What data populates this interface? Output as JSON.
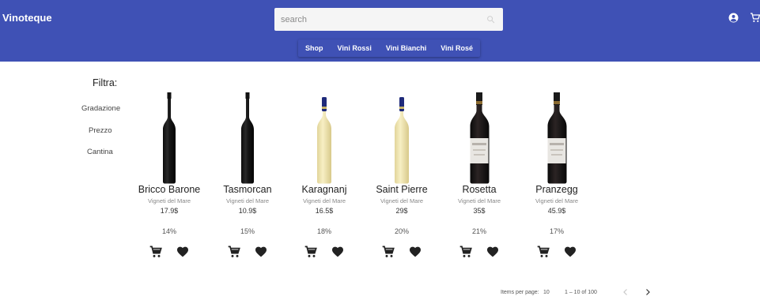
{
  "header": {
    "brand": "Vinoteque",
    "search_placeholder": "search",
    "icons": {
      "search": "search-icon",
      "account": "account-circle-icon",
      "cart": "shopping-cart-icon"
    },
    "colors": {
      "primary": "#3f51b5",
      "search_bg": "#f5f5f5"
    }
  },
  "nav": {
    "items": [
      {
        "label": "Shop"
      },
      {
        "label": "Vini Rossi"
      },
      {
        "label": "Vini Bianchi"
      },
      {
        "label": "Vini Rosé"
      }
    ]
  },
  "filters": {
    "title": "Filtra:",
    "items": [
      {
        "label": "Gradazione"
      },
      {
        "label": "Prezzo"
      },
      {
        "label": "Cantina"
      }
    ]
  },
  "products": [
    {
      "name": "Bricco Barone",
      "winery": "Vigneti del Mare",
      "price": "17.9$",
      "abv": "14%",
      "bottle": "red"
    },
    {
      "name": "Tasmorcan",
      "winery": "Vigneti del Mare",
      "price": "10.9$",
      "abv": "15%",
      "bottle": "red"
    },
    {
      "name": "Karagnanj",
      "winery": "Vigneti del Mare",
      "price": "16.5$",
      "abv": "18%",
      "bottle": "white"
    },
    {
      "name": "Saint Pierre",
      "winery": "Vigneti del Mare",
      "price": "29$",
      "abv": "20%",
      "bottle": "white"
    },
    {
      "name": "Rosetta",
      "winery": "Vigneti del Mare",
      "price": "35$",
      "abv": "21%",
      "bottle": "labeled"
    },
    {
      "name": "Pranzegg",
      "winery": "Vigneti del Mare",
      "price": "45.9$",
      "abv": "17%",
      "bottle": "labeled"
    }
  ],
  "product_actions": {
    "cart_icon": "add-to-cart-icon",
    "favorite_icon": "heart-icon"
  },
  "paginator": {
    "items_per_page_label": "Items per page:",
    "page_size": "10",
    "range_label": "1 – 10 of 100",
    "prev_icon": "chevron-left-icon",
    "next_icon": "chevron-right-icon"
  }
}
